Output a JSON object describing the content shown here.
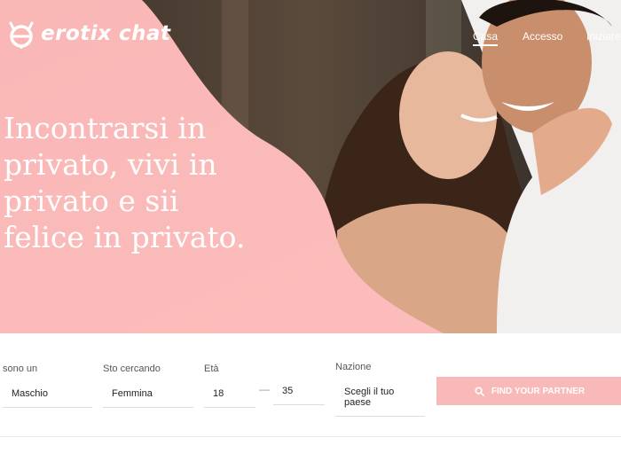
{
  "brand": {
    "name": "erotix chat",
    "accent": "#f9b9b8",
    "logo_icon": "devil-e-logo"
  },
  "nav": {
    "items": [
      {
        "label": "Casa"
      },
      {
        "label": "Accesso"
      },
      {
        "label": "Iniziare"
      }
    ],
    "active_index": 0
  },
  "hero": {
    "headline_lines": [
      "Incontrarsi in",
      "privato, vivi in",
      "privato e sii",
      "felice in privato."
    ],
    "image": "couple-embracing-photo"
  },
  "search": {
    "i_am": {
      "label": "sono un",
      "value": "Maschio"
    },
    "looking_for": {
      "label": "Sto cercando",
      "value": "Femmina"
    },
    "age": {
      "label": "Età",
      "from": "18",
      "separator": "—",
      "to": "35"
    },
    "country": {
      "label": "Nazione",
      "value": "Scegli il tuo paese"
    },
    "button": {
      "label": "FIND YOUR PARTNER",
      "icon": "search-icon"
    }
  }
}
